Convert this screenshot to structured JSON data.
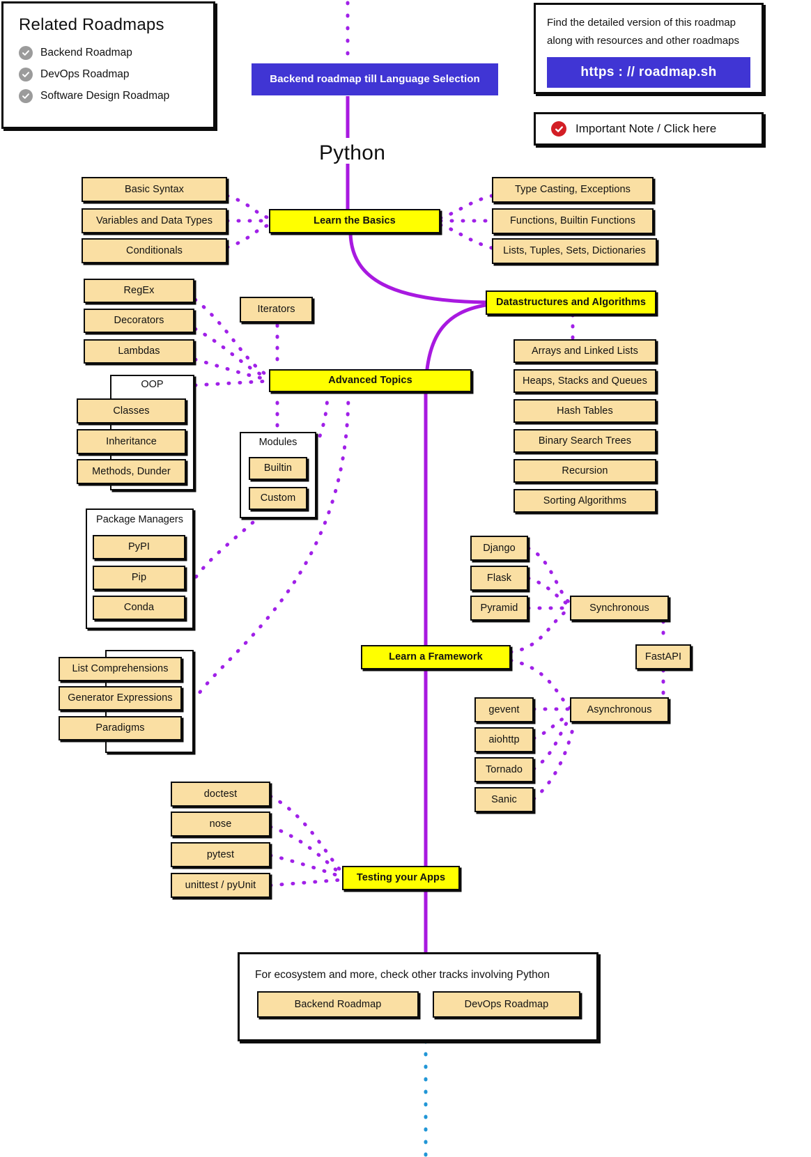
{
  "related_panel": {
    "title": "Related Roadmaps",
    "items": [
      {
        "label": "Backend Roadmap"
      },
      {
        "label": "DevOps Roadmap"
      },
      {
        "label": "Software Design Roadmap"
      }
    ],
    "check_color": "#9b9b9b"
  },
  "url_panel": {
    "line1": "Find the detailed version of this roadmap",
    "line2": "along with resources and other roadmaps",
    "button_label": "https : // roadmap.sh",
    "button_color": "#4035d4"
  },
  "note_panel": {
    "label": "Important Note / Click here",
    "check_color": "#d31e25"
  },
  "header": {
    "backend_banner": "Backend roadmap till Language Selection",
    "page_title": "Python"
  },
  "basics": {
    "main": "Learn the Basics",
    "left": [
      "Basic Syntax",
      "Variables and Data Types",
      "Conditionals"
    ],
    "right": [
      "Type Casting, Exceptions",
      "Functions, Builtin Functions",
      "Lists, Tuples, Sets, Dictionaries"
    ]
  },
  "advanced": {
    "main": "Advanced Topics",
    "left_stack": [
      "RegEx",
      "Decorators",
      "Lambdas"
    ],
    "iterators": "Iterators",
    "oop": {
      "title": "OOP",
      "items": [
        "Classes",
        "Inheritance",
        "Methods, Dunder"
      ]
    },
    "modules": {
      "title": "Modules",
      "items": [
        "Builtin",
        "Custom"
      ]
    },
    "package_managers": {
      "title": "Package Managers",
      "items": [
        "PyPI",
        "Pip",
        "Conda"
      ]
    },
    "comprehensions": [
      "List Comprehensions",
      "Generator Expressions",
      "Paradigms"
    ]
  },
  "dsa": {
    "main": "Datastructures and Algorithms",
    "items": [
      "Arrays and Linked Lists",
      "Heaps, Stacks and Queues",
      "Hash Tables",
      "Binary Search Trees",
      "Recursion",
      "Sorting Algorithms"
    ]
  },
  "framework": {
    "main": "Learn a Framework",
    "synchronous": "Synchronous",
    "asynchronous": "Asynchronous",
    "fastapi": "FastAPI",
    "sync_items": [
      "Django",
      "Flask",
      "Pyramid"
    ],
    "async_items": [
      "gevent",
      "aiohttp",
      "Tornado",
      "Sanic"
    ]
  },
  "testing": {
    "main": "Testing your Apps",
    "items": [
      "doctest",
      "nose",
      "pytest",
      "unittest / pyUnit"
    ]
  },
  "ecosystem": {
    "caption": "For ecosystem and more, check other tracks involving Python",
    "buttons": [
      "Backend Roadmap",
      "DevOps Roadmap"
    ]
  },
  "colors": {
    "node_tan": "#fadfa3",
    "node_yellow": "#ffff00",
    "wire_purple": "#a819e0",
    "wire_dotted": "#a020e8",
    "wire_blue_dotted": "#2196d6"
  }
}
